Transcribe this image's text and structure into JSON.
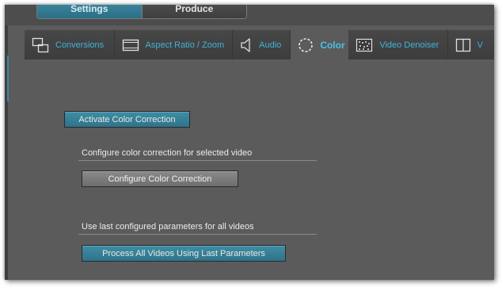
{
  "mode_toggle": {
    "settings_label": "Settings",
    "produce_label": "Produce"
  },
  "tabs": [
    {
      "label": "Conversions",
      "icon": "conversions-icon"
    },
    {
      "label": "Aspect Ratio / Zoom",
      "icon": "aspect-ratio-icon"
    },
    {
      "label": "Audio",
      "icon": "speaker-icon"
    },
    {
      "label": "Color",
      "icon": "color-circle-icon",
      "active": true
    },
    {
      "label": "Video Denoiser",
      "icon": "denoiser-icon"
    },
    {
      "label": "V",
      "icon": "split-view-icon"
    }
  ],
  "color_panel": {
    "activate_button": "Activate Color Correction",
    "configure_section_label": "Configure color correction for selected video",
    "configure_button": "Configure Color Correction",
    "last_params_section_label": "Use last configured parameters for all videos",
    "process_all_button": "Process All Videos Using Last Parameters"
  },
  "colors": {
    "accent": "#3fb3d8",
    "panel_bg": "#5b5b5b",
    "tabbar_bg": "#414141",
    "teal_button": "#36809a",
    "gray_button": "#7c7c7c"
  }
}
